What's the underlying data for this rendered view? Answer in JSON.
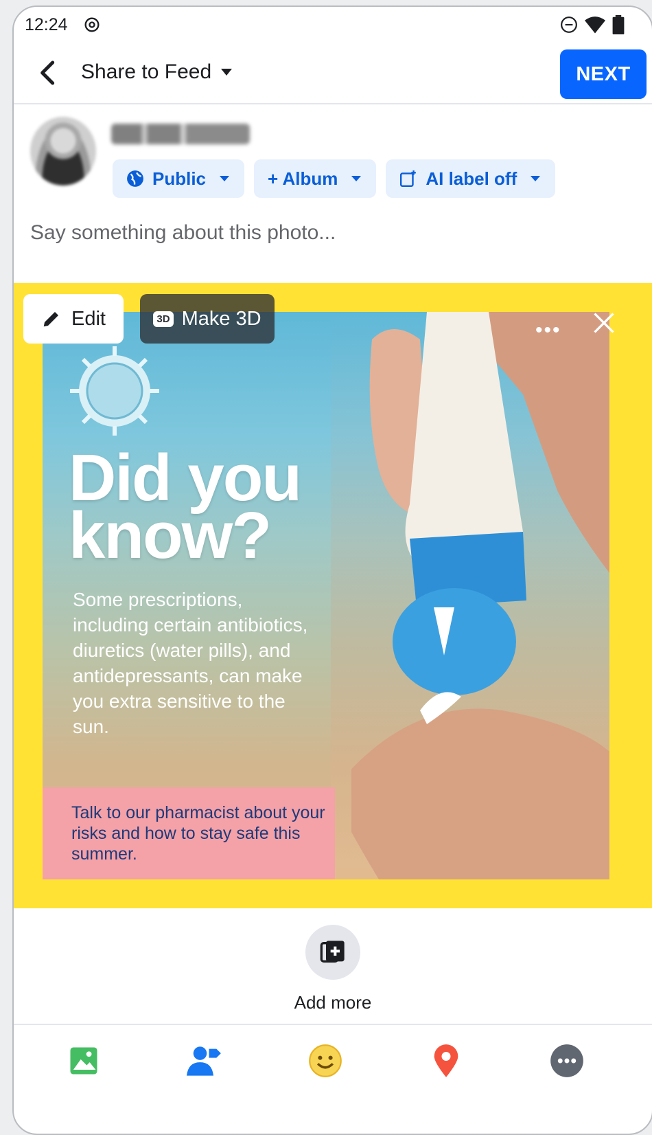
{
  "status_bar": {
    "time": "12:24"
  },
  "header": {
    "title": "Share to Feed",
    "next_label": "NEXT"
  },
  "audience_chips": [
    {
      "label": "Public",
      "icon": "globe-icon"
    },
    {
      "label": "+ Album",
      "icon": "plus-icon"
    },
    {
      "label": "AI label off",
      "icon": "ai-label-icon"
    }
  ],
  "composer": {
    "placeholder": "Say something about this photo..."
  },
  "photo_controls": {
    "edit_label": "Edit",
    "make3d_label": "Make 3D",
    "badge": "3D"
  },
  "photo_content": {
    "headline_line1": "Did you",
    "headline_line2": "know?",
    "body": "Some prescriptions, including certain antibiotics, diuretics (water pills), and antidepressants, can make you extra sensitive to the sun.",
    "footer": "Talk to our pharmacist about your risks and how to stay safe this summer."
  },
  "add_more": {
    "label": "Add more"
  },
  "bottom_icons": [
    "photo-icon",
    "tag-people-icon",
    "feeling-icon",
    "location-icon",
    "more-icon"
  ],
  "colors": {
    "accent": "#0866ff",
    "frame": "#ffe234",
    "pink": "#f4a1a8"
  }
}
